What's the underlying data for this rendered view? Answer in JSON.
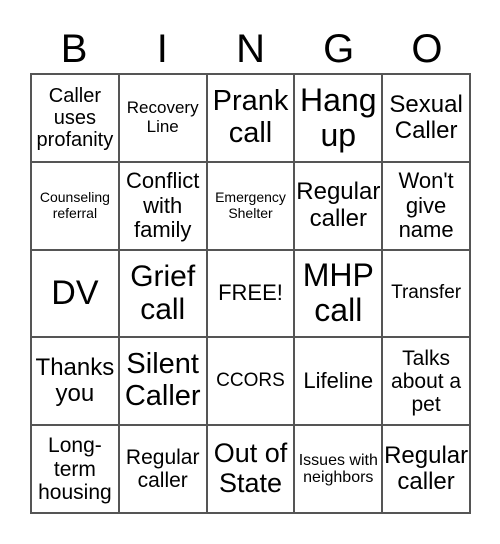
{
  "header": [
    "B",
    "I",
    "N",
    "G",
    "O"
  ],
  "cells": [
    {
      "text": "Caller uses profanity",
      "size": "sz20"
    },
    {
      "text": "Recovery Line",
      "size": "sz17"
    },
    {
      "text": "Prank call",
      "size": "sz29"
    },
    {
      "text": "Hang up",
      "size": "sz32"
    },
    {
      "text": "Sexual Caller",
      "size": "sz24"
    },
    {
      "text": "Counseling referral",
      "size": "sz14"
    },
    {
      "text": "Conflict with family",
      "size": "sz22"
    },
    {
      "text": "Emergency Shelter",
      "size": "sz14"
    },
    {
      "text": "Regular caller",
      "size": "sz24"
    },
    {
      "text": "Won't give name",
      "size": "sz22"
    },
    {
      "text": "DV",
      "size": "sz34"
    },
    {
      "text": "Grief call",
      "size": "sz30"
    },
    {
      "text": "FREE!",
      "size": "sz22"
    },
    {
      "text": "MHP call",
      "size": "sz32"
    },
    {
      "text": "Transfer",
      "size": "sz19"
    },
    {
      "text": "Thanks you",
      "size": "sz24"
    },
    {
      "text": "Silent Caller",
      "size": "sz29"
    },
    {
      "text": "CCORS",
      "size": "sz19"
    },
    {
      "text": "Lifeline",
      "size": "sz22"
    },
    {
      "text": "Talks about a pet",
      "size": "sz21"
    },
    {
      "text": "Long-term housing",
      "size": "sz21"
    },
    {
      "text": "Regular caller",
      "size": "sz21"
    },
    {
      "text": "Out of State",
      "size": "sz27"
    },
    {
      "text": "Issues with neighbors",
      "size": "sz16"
    },
    {
      "text": "Regular caller",
      "size": "sz24"
    }
  ]
}
